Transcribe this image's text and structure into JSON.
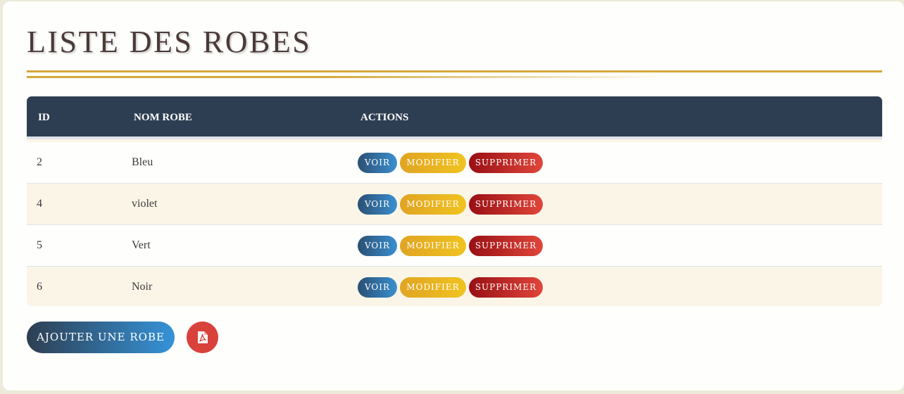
{
  "page": {
    "title": "LISTE DES ROBES"
  },
  "table": {
    "headers": {
      "id": "ID",
      "name": "NOM ROBE",
      "actions": "ACTIONS"
    },
    "rows": [
      {
        "id": "2",
        "name": "Bleu"
      },
      {
        "id": "4",
        "name": "violet"
      },
      {
        "id": "5",
        "name": "Vert"
      },
      {
        "id": "6",
        "name": "Noir"
      }
    ],
    "actions": {
      "view_label": "VOIR",
      "edit_label": "MODIFIER",
      "delete_label": "SUPPRIMER"
    }
  },
  "footer": {
    "add_label": "AJOUTER UNE ROBE",
    "pdf_icon": "file-pdf-icon"
  },
  "colors": {
    "header_bg": "#2e3e52",
    "accent_gold": "#d4a83a",
    "view_button": "#2b5073",
    "edit_button": "#e0a423",
    "delete_button": "#990f14",
    "pdf_button": "#d8423a",
    "row_alt_bg": "#fbf5e8"
  }
}
